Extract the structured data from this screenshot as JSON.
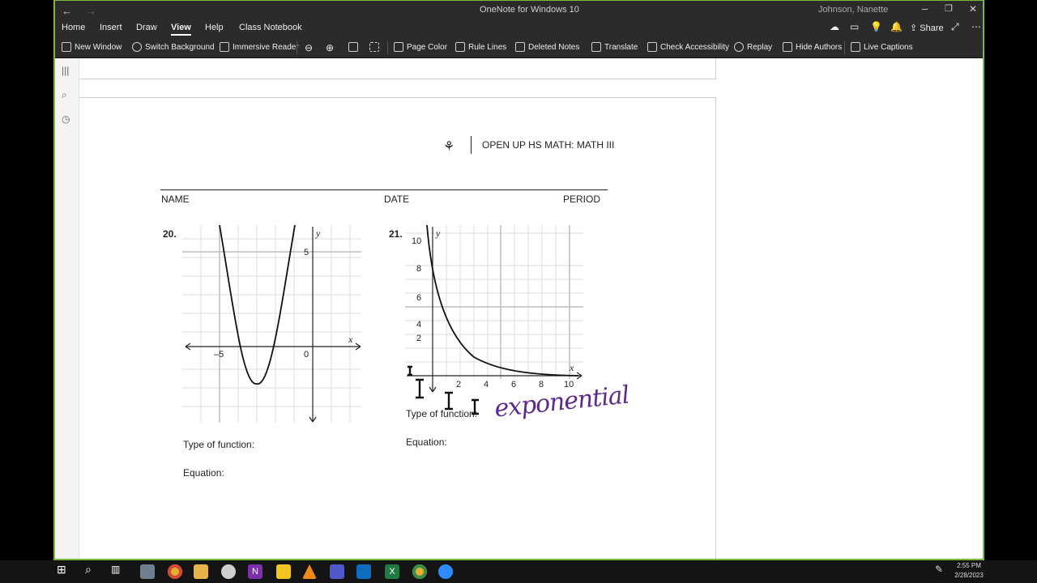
{
  "window": {
    "title": "OneNote for Windows 10",
    "user": "Johnson, Nanette"
  },
  "menu": [
    "Home",
    "Insert",
    "Draw",
    "View",
    "Help",
    "Class Notebook"
  ],
  "ribbon": {
    "new_window": "New Window",
    "switch_background": "Switch Background",
    "immersive_reader": "Immersive Reader",
    "page_color": "Page Color",
    "rule_lines": "Rule Lines",
    "deleted_notes": "Deleted Notes",
    "translate": "Translate",
    "check_accessibility": "Check Accessibility",
    "replay": "Replay",
    "hide_authors": "Hide Authors",
    "live_captions": "Live Captions",
    "share": "Share"
  },
  "worksheet": {
    "course": "OPEN UP HS MATH: MATH III",
    "name_label": "NAME",
    "date_label": "DATE",
    "period_label": "PERIOD",
    "p20": {
      "number": "20.",
      "type_label": "Type of function:",
      "equation_label": "Equation:",
      "ticks": {
        "x_neg5": "–5",
        "x_0": "0",
        "y_5": "5",
        "x_axis": "x",
        "y_axis": "y"
      }
    },
    "p21": {
      "number": "21.",
      "type_label": "Type of function:",
      "equation_label": "Equation:",
      "handwritten_answer": "exponential",
      "ticks": {
        "y10": "10",
        "y8": "8",
        "y6": "6",
        "y4": "4",
        "y2": "2",
        "x2": "2",
        "x4": "4",
        "x6": "6",
        "x8": "8",
        "x10": "10",
        "x_axis": "x",
        "y_axis": "y"
      }
    }
  },
  "taskbar": {
    "time": "2:55 PM",
    "date": "2/28/2023"
  }
}
